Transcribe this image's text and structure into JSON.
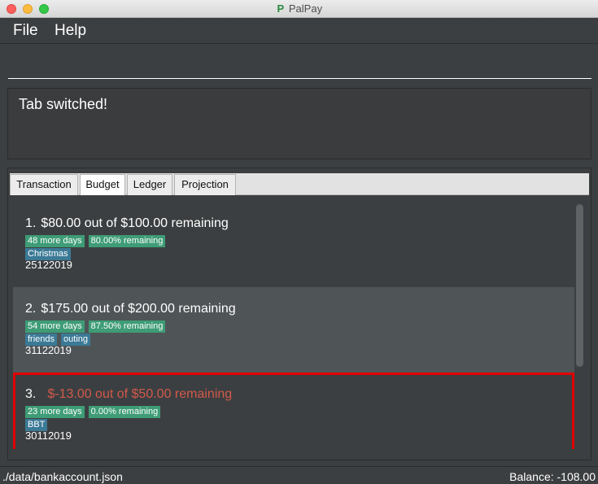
{
  "window": {
    "title": "PalPay",
    "icon": "paypal-icon",
    "icon_glyph": "P"
  },
  "menu": {
    "file": "File",
    "help": "Help"
  },
  "command": {
    "value": "",
    "placeholder": ""
  },
  "result": {
    "text": "Tab switched!"
  },
  "tabs": [
    {
      "label": "Transaction",
      "active": false
    },
    {
      "label": "Budget",
      "active": true
    },
    {
      "label": "Ledger",
      "active": false
    },
    {
      "label": "Projection",
      "active": false
    }
  ],
  "budgets": [
    {
      "index": "1.",
      "title": "$80.00 out of $100.00 remaining",
      "days": "48 more days",
      "percent": "80.00% remaining",
      "tags": [
        "Christmas"
      ],
      "date": "25122019"
    },
    {
      "index": "2.",
      "title": "$175.00 out of $200.00 remaining",
      "days": "54 more days",
      "percent": "87.50% remaining",
      "tags": [
        "friends",
        "outing"
      ],
      "date": "31122019"
    },
    {
      "index": "3.",
      "title": "$-13.00 out of $50.00 remaining",
      "days": "23 more days",
      "percent": "0.00% remaining",
      "tags": [
        "BBT"
      ],
      "date": "30112019"
    }
  ],
  "status": {
    "path": "./data/bankaccount.json",
    "balance": "Balance: -108.00"
  },
  "colors": {
    "background": "#3c3f41",
    "tag_green": "#3e9c76",
    "tag_blue": "#3b7a96",
    "overspent_text": "#d2594a",
    "selected_border": "#e00000"
  }
}
